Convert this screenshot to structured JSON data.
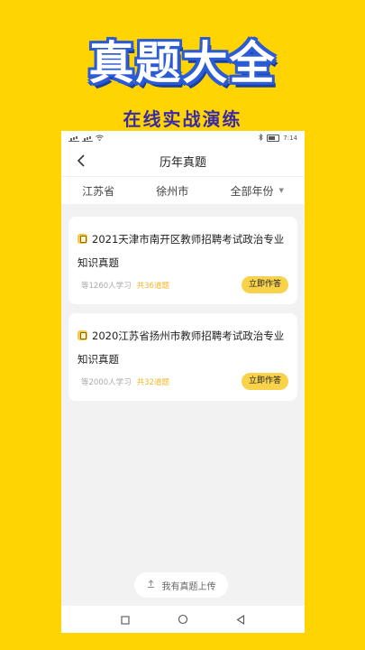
{
  "hero": {
    "title": "真题大全",
    "subtitle": "在线实战演练"
  },
  "statusbar": {
    "time": "7:14"
  },
  "nav": {
    "title": "历年真题"
  },
  "filters": {
    "province": "江苏省",
    "city": "徐州市",
    "year": "全部年份"
  },
  "cards": [
    {
      "title": "2021天津市南开区教师招聘考试政治专业知识真题",
      "learners": "等1260人学习",
      "count": "共36道题",
      "button": "立即作答"
    },
    {
      "title": "2020江苏省扬州市教师招聘考试政治专业知识真题",
      "learners": "等2000人学习",
      "count": "共32道题",
      "button": "立即作答"
    }
  ],
  "upload": {
    "label": "我有真题上传"
  },
  "colors": {
    "background": "#FFD400",
    "accent": "#F8D24A",
    "title_outline": "#2C5BD6",
    "subtitle": "#3B2AA8"
  }
}
